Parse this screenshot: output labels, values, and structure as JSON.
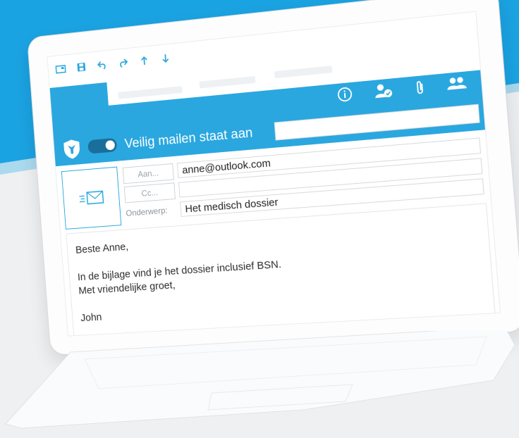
{
  "toolbar": {
    "icons": [
      "window-icon",
      "save-icon",
      "undo-icon",
      "redo-icon",
      "up-arrow-icon",
      "down-arrow-icon"
    ]
  },
  "ribbon": {
    "icons": [
      "info-icon",
      "contact-verified-icon",
      "paperclip-icon",
      "people-icon"
    ]
  },
  "secure_mail": {
    "label": "Veilig mailen staat aan",
    "toggle_on": true
  },
  "header": {
    "to_button": "Aan...",
    "cc_button": "Cc...",
    "subject_label": "Onderwerp:",
    "to_value": "anne@outlook.com",
    "cc_value": "",
    "subject_value": "Het medisch dossier"
  },
  "body": {
    "greeting": "Beste Anne,",
    "line1": "In de bijlage vind je het dossier inclusief BSN.",
    "line2": "Met vriendelijke groet,",
    "signature": "John"
  },
  "colors": {
    "accent": "#2aa7df",
    "toggle": "#1a6f9a",
    "background_top": "#1aa3e2"
  }
}
